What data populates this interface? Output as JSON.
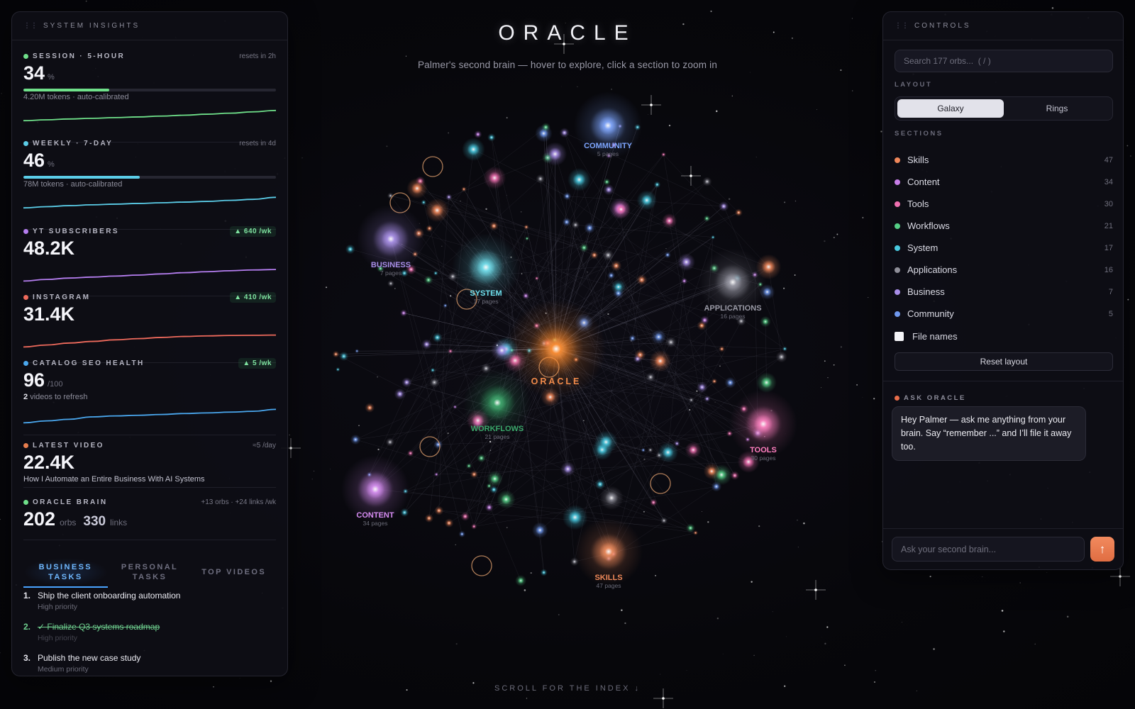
{
  "header": {
    "title": "ORACLE",
    "subtitle": "Palmer's second brain — hover to explore, click a section to zoom in",
    "scroll_hint": "SCROLL FOR THE INDEX ↓"
  },
  "insights": {
    "panel_title": "SYSTEM INSIGHTS",
    "grip_icon": "drag-handle-icon",
    "session": {
      "label": "SESSION · 5-HOUR",
      "resets": "resets in 2h",
      "value": "34",
      "unit": "%",
      "progress": 0.34,
      "note": "4.20M tokens · auto-calibrated",
      "color": "#6fe08a",
      "spark": [
        0.2,
        0.25,
        0.3,
        0.34,
        0.38,
        0.42,
        0.47,
        0.52,
        0.58,
        0.64,
        0.72,
        0.8
      ]
    },
    "weekly": {
      "label": "WEEKLY · 7-DAY",
      "resets": "resets in 4d",
      "value": "46",
      "unit": "%",
      "progress": 0.46,
      "note": "78M tokens · auto-calibrated",
      "color": "#5bcde8",
      "spark": [
        0.2,
        0.27,
        0.33,
        0.38,
        0.42,
        0.46,
        0.5,
        0.54,
        0.58,
        0.64,
        0.7,
        0.82
      ]
    },
    "yt": {
      "label": "YT SUBSCRIBERS",
      "delta": "▲ 640 /wk",
      "value": "48.2K",
      "color": "#b57ef0",
      "spark": [
        0.2,
        0.28,
        0.35,
        0.4,
        0.45,
        0.5,
        0.56,
        0.62,
        0.67,
        0.72,
        0.76,
        0.78
      ]
    },
    "instagram": {
      "label": "INSTAGRAM",
      "delta": "▲ 410 /wk",
      "value": "31.4K",
      "color": "#ee6a5c",
      "spark": [
        0.2,
        0.3,
        0.4,
        0.48,
        0.56,
        0.62,
        0.68,
        0.73,
        0.76,
        0.78,
        0.79,
        0.8
      ]
    },
    "seo": {
      "label": "CATALOG SEO HEALTH",
      "delta": "▲ 5 /wk",
      "value": "96",
      "unit": "/100",
      "note_count": "2",
      "note_text": "videos to refresh",
      "color": "#4aa7ee",
      "spark": [
        0.2,
        0.3,
        0.38,
        0.5,
        0.55,
        0.58,
        0.62,
        0.67,
        0.7,
        0.74,
        0.78,
        0.88
      ]
    },
    "latest_video": {
      "label": "LATEST VIDEO",
      "rate": "≈5 /day",
      "value": "22.4K",
      "note": "How I Automate an Entire Business With AI Systems",
      "color": "#e87e4e"
    },
    "brain": {
      "label": "ORACLE BRAIN",
      "rate": "+13 orbs · +24 links /wk",
      "orbs": "202",
      "orbs_unit": "orbs",
      "links": "330",
      "links_unit": "links",
      "color": "#6fe08a"
    },
    "tabs": [
      {
        "label": "BUSINESS TASKS",
        "active": true
      },
      {
        "label": "PERSONAL TASKS",
        "active": false
      },
      {
        "label": "TOP VIDEOS",
        "active": false
      }
    ],
    "tasks": [
      {
        "num": "1.",
        "title": "Ship the client onboarding automation",
        "priority": "High priority",
        "done": false
      },
      {
        "num": "2.",
        "title": "✓ Finalize Q3 systems roadmap",
        "priority": "High priority",
        "done": true
      },
      {
        "num": "3.",
        "title": "Publish the new case study",
        "priority": "Medium priority",
        "done": false
      }
    ]
  },
  "controls": {
    "panel_title": "CONTROLS",
    "search_placeholder": "Search 177 orbs...  ( / )",
    "layout_label": "LAYOUT",
    "layout_options": [
      {
        "label": "Galaxy",
        "active": true
      },
      {
        "label": "Rings",
        "active": false
      }
    ],
    "sections_label": "SECTIONS",
    "sections": [
      {
        "name": "Skills",
        "count": "47",
        "color": "#f0875a"
      },
      {
        "name": "Content",
        "count": "34",
        "color": "#c77ee8"
      },
      {
        "name": "Tools",
        "count": "30",
        "color": "#ef6fb0"
      },
      {
        "name": "Workflows",
        "count": "21",
        "color": "#55cf86"
      },
      {
        "name": "System",
        "count": "17",
        "color": "#48c9e0"
      },
      {
        "name": "Applications",
        "count": "16",
        "color": "#8f8f99"
      },
      {
        "name": "Business",
        "count": "7",
        "color": "#a88ee8"
      },
      {
        "name": "Community",
        "count": "5",
        "color": "#6f98ee"
      }
    ],
    "file_names_label": "File names",
    "file_names_checked": false,
    "reset_label": "Reset layout",
    "ask_label": "ASK ORACLE",
    "ask_dot_color": "#e86d4a",
    "greeting": "Hey Palmer — ask me anything from your brain. Say “remember ...” and I’ll file it away too.",
    "ask_placeholder": "Ask your second brain...",
    "send_glyph": "↑"
  },
  "galaxy": {
    "center": {
      "label": "ORACLE",
      "color": "#ff8a2a"
    },
    "hubs": [
      {
        "name": "COMMUNITY",
        "pages": "5 pages",
        "color": "#7ea6ff"
      },
      {
        "name": "BUSINESS",
        "pages": "7 pages",
        "color": "#a88ee8"
      },
      {
        "name": "SYSTEM",
        "pages": "17 pages",
        "color": "#6fe0ee"
      },
      {
        "name": "APPLICATIONS",
        "pages": "16 pages",
        "color": "#9a9aa6"
      },
      {
        "name": "WORKFLOWS",
        "pages": "21 pages",
        "color": "#3aa86a"
      },
      {
        "name": "TOOLS",
        "pages": "30 pages",
        "color": "#ff7fc0"
      },
      {
        "name": "CONTENT",
        "pages": "34 pages",
        "color": "#d68cf2"
      },
      {
        "name": "SKILLS",
        "pages": "47 pages",
        "color": "#f08a5a"
      }
    ]
  }
}
